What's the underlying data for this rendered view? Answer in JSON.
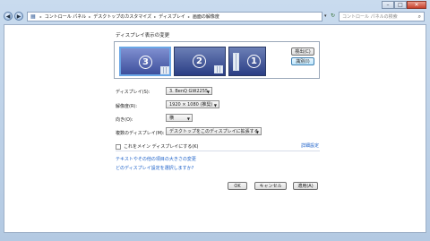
{
  "window": {
    "controls": {
      "minimize": "–",
      "maximize": "□",
      "close": "✕"
    }
  },
  "nav": {
    "breadcrumbs": [
      "コントロール パネル",
      "デスクトップのカスタマイズ",
      "ディスプレイ",
      "画面の解像度"
    ],
    "search_placeholder": "コントロール パネルの検索"
  },
  "main": {
    "heading": "ディスプレイ表示の変更",
    "detect_label": "検出(C)",
    "identify_label": "識別(I)",
    "monitors": [
      {
        "number": "3"
      },
      {
        "number": "2"
      },
      {
        "number": "1"
      }
    ],
    "display_label": "ディスプレイ(S):",
    "display_value": "3. BenQ GW2255",
    "resolution_label": "解像度(R):",
    "resolution_value": "1920 × 1080 (推奨)",
    "orientation_label": "向き(O):",
    "orientation_value": "横",
    "multi_label": "複数のディスプレイ(M):",
    "multi_value": "デスクトップをこのディスプレイに拡張する",
    "main_checkbox_label": "これをメイン ディスプレイにする(K)",
    "advanced_link": "詳細設定",
    "link1": "テキストやその他の項目の大きさの変更",
    "link2": "どのディスプレイ設定を選択しますか?",
    "ok_label": "OK",
    "cancel_label": "キャンセル",
    "apply_label": "適用(A)"
  },
  "colors": {
    "accent_link": "#1a5fc8",
    "heading": "#1a4fa0",
    "monitor_fill": "#3d4f9c"
  }
}
